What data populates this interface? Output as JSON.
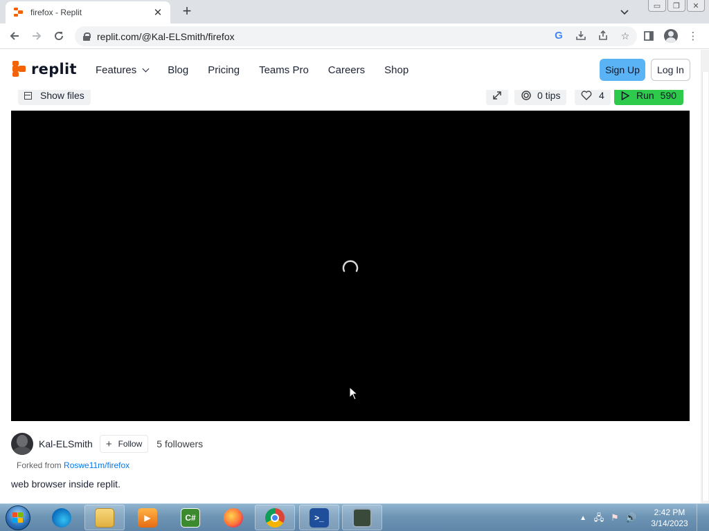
{
  "browser": {
    "tab_title": "firefox - Replit",
    "url": "replit.com/@Kal-ELSmith/firefox"
  },
  "site": {
    "logo_text": "replit",
    "nav": [
      "Features",
      "Blog",
      "Pricing",
      "Teams Pro",
      "Careers",
      "Shop"
    ],
    "signup": "Sign Up",
    "login": "Log In"
  },
  "repl": {
    "show_files": "Show files",
    "tips": "0 tips",
    "likes": "4",
    "run_label": "Run",
    "run_count": "590"
  },
  "author": {
    "name": "Kal-ELSmith",
    "follow": "Follow",
    "followers": "5 followers",
    "forked_prefix": "Forked from",
    "forked_link": "Roswe11m/firefox",
    "description": "web browser inside replit."
  },
  "taskbar": {
    "time": "2:42 PM",
    "date": "3/14/2023"
  }
}
